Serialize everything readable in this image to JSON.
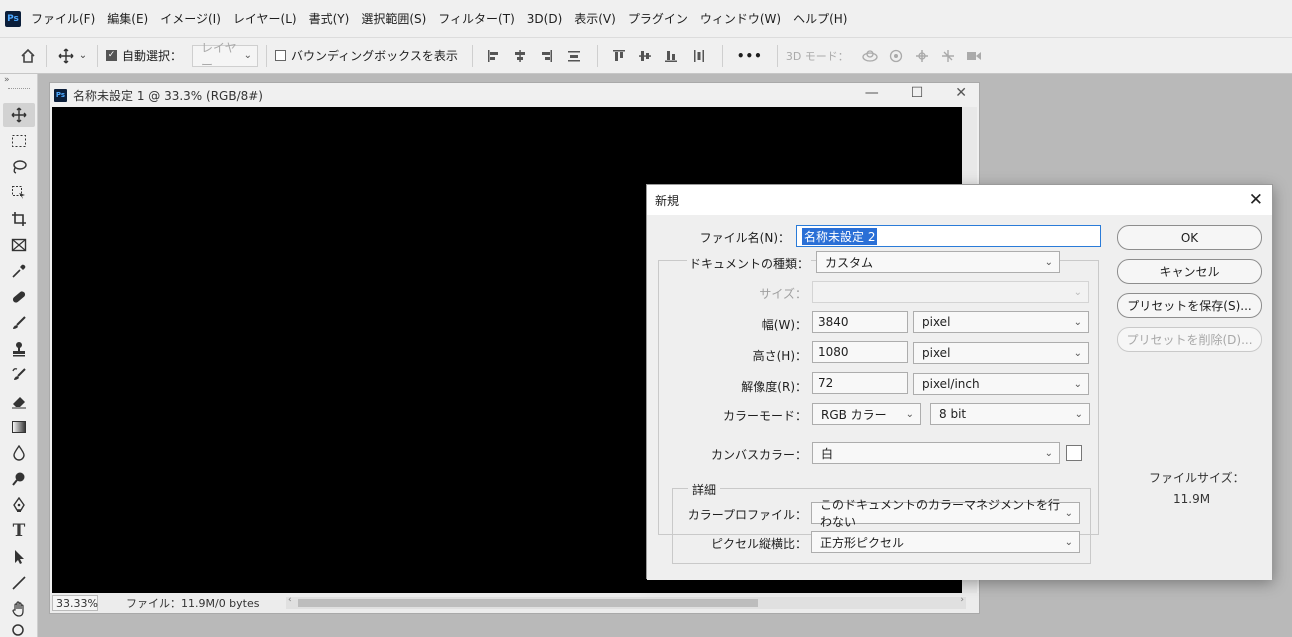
{
  "menubar": {
    "logo": "Ps",
    "items": [
      "ファイル(F)",
      "編集(E)",
      "イメージ(I)",
      "レイヤー(L)",
      "書式(Y)",
      "選択範囲(S)",
      "フィルター(T)",
      "3D(D)",
      "表示(V)",
      "プラグイン",
      "ウィンドウ(W)",
      "ヘルプ(H)"
    ]
  },
  "options": {
    "auto_select_label": "自動選択：",
    "layer_select": "レイヤー",
    "bbox_label": "バウンディングボックスを表示",
    "more": "•••",
    "mode3d_label": "3D モード："
  },
  "document": {
    "title": "名称未設定 1 @ 33.3% (RGB/8#)",
    "zoom": "33.33%",
    "file_info": "ファイル：11.9M/0 bytes",
    "min_glyph": "—",
    "max_glyph": "☐",
    "close_glyph": "✕",
    "canvas_color": "#000000"
  },
  "dialog": {
    "title": "新規",
    "close_glyph": "✕",
    "filename_label": "ファイル名(N)：",
    "filename_value": "名称未設定 2",
    "doctype_label": "ドキュメントの種類：",
    "doctype_value": "カスタム",
    "size_label": "サイズ：",
    "size_value": "",
    "width_label": "幅(W)：",
    "width_value": "3840",
    "width_unit": "pixel",
    "height_label": "高さ(H)：",
    "height_value": "1080",
    "height_unit": "pixel",
    "res_label": "解像度(R)：",
    "res_value": "72",
    "res_unit": "pixel/inch",
    "colormode_label": "カラーモード：",
    "colormode_value": "RGB カラー",
    "bitdepth_value": "8 bit",
    "canvascolor_label": "カンバスカラー：",
    "canvascolor_value": "白",
    "details_title": "詳細",
    "profile_label": "カラープロファイル：",
    "profile_value": "このドキュメントのカラーマネジメントを行わない",
    "aspect_label": "ピクセル縦横比：",
    "aspect_value": "正方形ピクセル",
    "ok": "OK",
    "cancel": "キャンセル",
    "save_preset": "プリセットを保存(S)...",
    "delete_preset": "プリセットを削除(D)...",
    "filesize_label": "ファイルサイズ：",
    "filesize_value": "11.9M"
  },
  "tools": {
    "icons": [
      "move-tool-icon",
      "marquee-tool-icon",
      "lasso-tool-icon",
      "object-select-tool-icon",
      "crop-tool-icon",
      "frame-tool-icon",
      "eyedropper-tool-icon",
      "healing-brush-tool-icon",
      "brush-tool-icon",
      "clone-stamp-tool-icon",
      "history-brush-tool-icon",
      "eraser-tool-icon",
      "gradient-tool-icon",
      "blur-tool-icon",
      "dodge-tool-icon",
      "pen-tool-icon",
      "type-tool-icon",
      "path-select-tool-icon",
      "line-tool-icon",
      "hand-tool-icon",
      "zoom-tool-icon"
    ],
    "type_glyph": "T"
  }
}
